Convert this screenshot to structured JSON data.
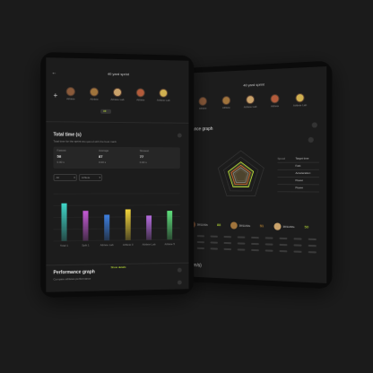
{
  "back_tablet": {
    "header_title": "40 yard sprint",
    "athletes": [
      {
        "name": "Athlete"
      },
      {
        "name": "Athlete"
      },
      {
        "name": "Athlete Lab"
      },
      {
        "name": "Athlete"
      },
      {
        "name": "Athlete Lab"
      }
    ],
    "section_title": "ance graph",
    "legend": [
      {
        "label": "Speed",
        "value": "Target time"
      },
      {
        "label": "",
        "value": "Fast"
      },
      {
        "label": "",
        "value": "Acceleration"
      },
      {
        "label": "",
        "value": "Power"
      },
      {
        "label": "",
        "value": "Power"
      }
    ],
    "bottom_stats": [
      {
        "label": "38/11/00s",
        "score": "88"
      },
      {
        "label": "38/11/00s",
        "score": "51"
      },
      {
        "label": "38/11/00s",
        "score": "50"
      }
    ],
    "footer_text": "(m/s)"
  },
  "front_tablet": {
    "header_title": "40 yard sprint",
    "athletes": [
      {
        "name": "Athlete"
      },
      {
        "name": "Athlete"
      },
      {
        "name": "Athlete Lab"
      },
      {
        "name": "Athlete"
      },
      {
        "name": "Athlete Lab"
      }
    ],
    "chip_label": "All",
    "section_title": "Total time (s)",
    "section_sub": "Total time for the sprint compared with the best mark",
    "stats": [
      {
        "label": "Fastest",
        "value": "58",
        "sub": "0.00 s"
      },
      {
        "label": "Average",
        "value": "87",
        "sub": "0.00 s"
      },
      {
        "label": "Slowest",
        "value": "77",
        "sub": "0.00 s"
      }
    ],
    "filters": [
      "All",
      "Athlete"
    ],
    "bars_label_row": [
      "Total 1",
      "Split 1",
      "Athlete Lab",
      "Athlete 3",
      "Athlete Lab",
      "Athlete 5"
    ],
    "show_details": "Show details",
    "bottom_title": "Performance graph",
    "bottom_sub": "Compare athletes performance"
  },
  "chart_data": {
    "type": "bar",
    "categories": [
      "Total 1",
      "Split 1",
      "Athlete Lab",
      "Athlete 3",
      "Athlete Lab",
      "Athlete 5"
    ],
    "values": [
      64,
      51,
      44,
      53,
      42,
      50
    ],
    "ylim": [
      0,
      80
    ],
    "colors": [
      "#3fd6c8",
      "#c55ad6",
      "#3d7fe0",
      "#f2d43b",
      "#b66ce0",
      "#5ee07c"
    ]
  },
  "colors": {
    "accent": "#c9f23b",
    "screen_bg": "#1c1c1c",
    "frame": "#0b0b0b"
  }
}
